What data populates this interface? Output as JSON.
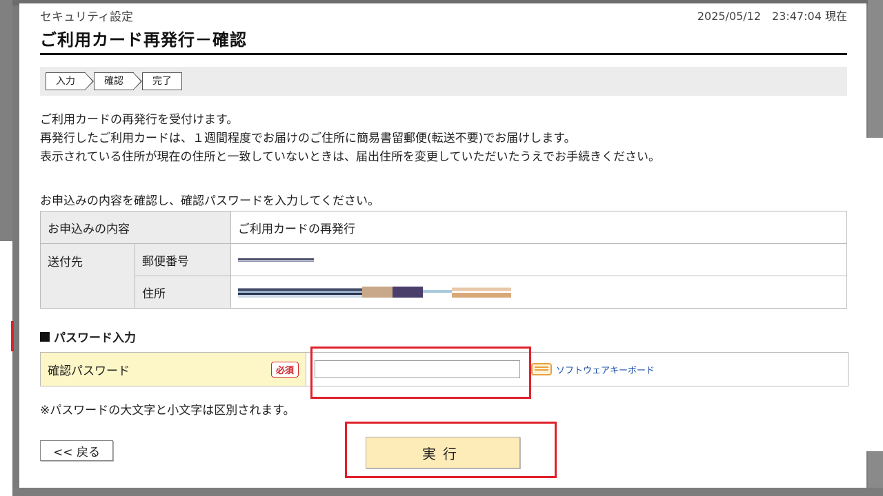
{
  "header": {
    "breadcrumb": "セキュリティ設定",
    "datetime": "2025/05/12　23:47:04 現在",
    "title": "ご利用カード再発行－確認"
  },
  "steps": [
    "入力",
    "確認",
    "完了"
  ],
  "description": [
    "ご利用カードの再発行を受付けます。",
    "再発行したご利用カードは、１週間程度でお届けのご住所に簡易書留郵便(転送不要)でお届けします。",
    "表示されている住所が現在の住所と一致していないときは、届出住所を変更していただいたうえでお手続きください。"
  ],
  "instruction": "お申込みの内容を確認し、確認パスワードを入力してください。",
  "table": {
    "row1_label": "お申込みの内容",
    "row1_value": "ご利用カードの再発行",
    "row2_label": "送付先",
    "postal_label": "郵便番号",
    "address_label": "住所"
  },
  "password_section": {
    "heading": "パスワード入力",
    "label": "確認パスワード",
    "required": "必須",
    "keyboard_link": "ソフトウェアキーボード",
    "note": "※パスワードの大文字と小文字は区別されます。"
  },
  "buttons": {
    "back": "<< 戻る",
    "execute": "実行"
  }
}
